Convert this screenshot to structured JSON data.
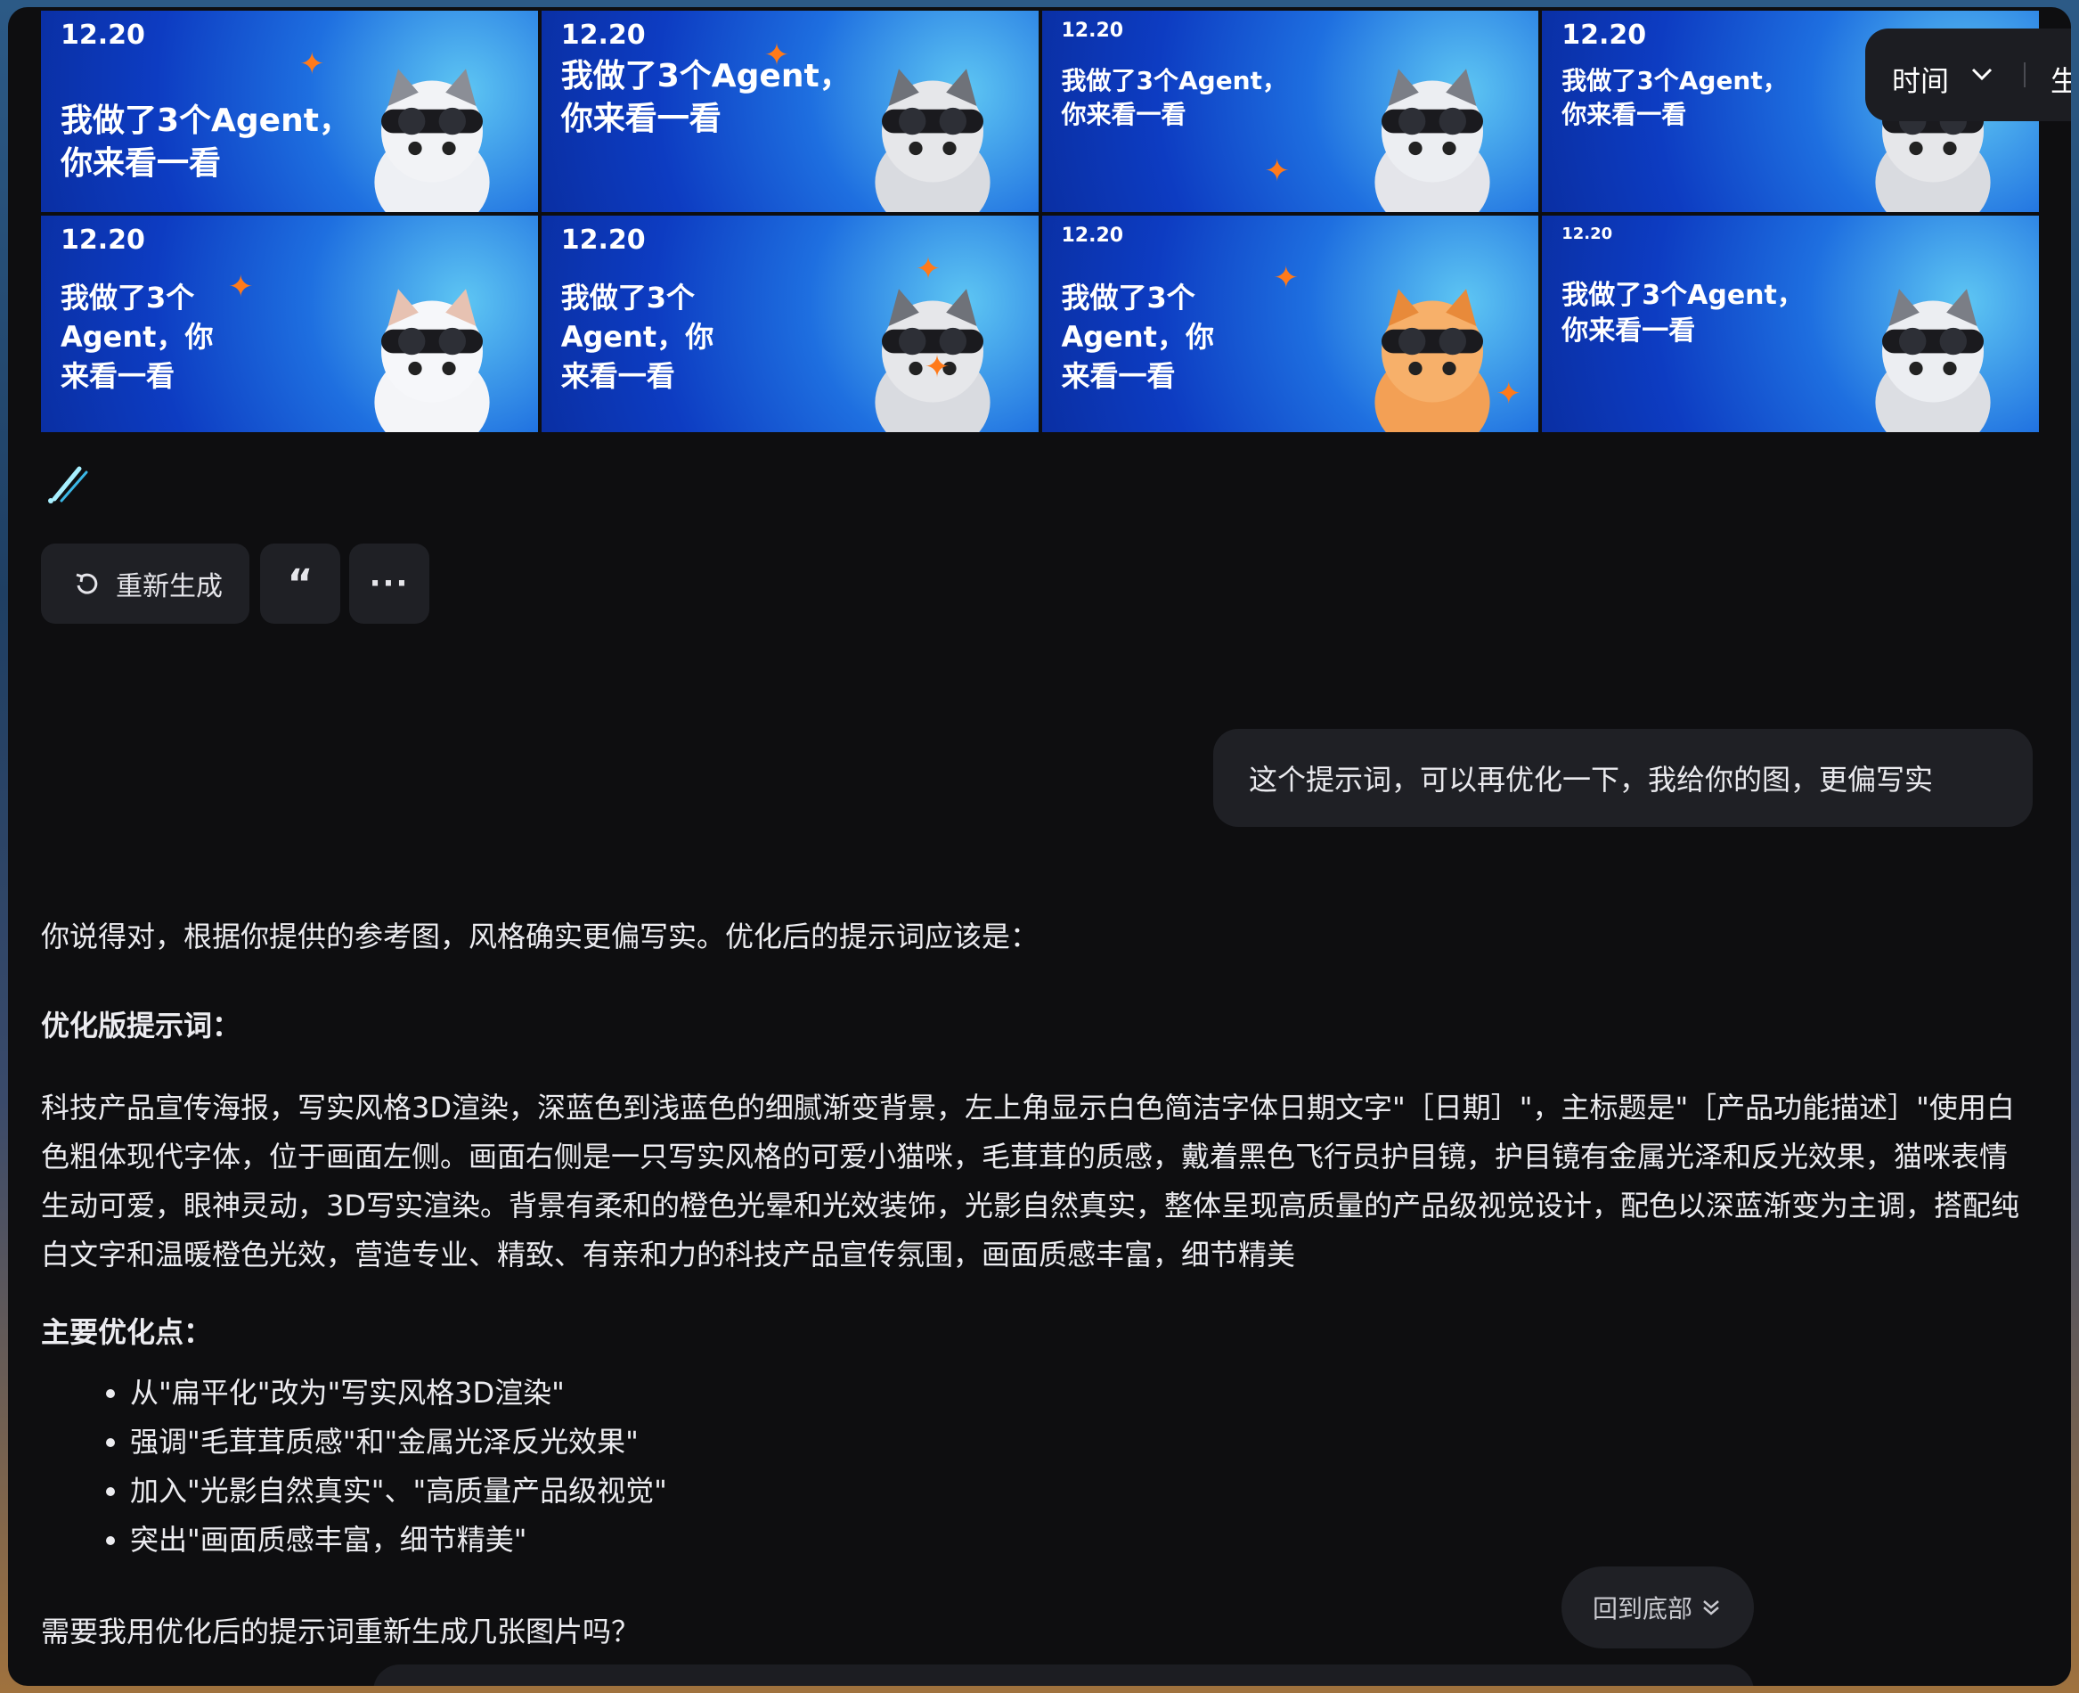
{
  "toolbar": {
    "time_label": "时间",
    "gen_label": "生"
  },
  "posters": [
    {
      "date": "12.20",
      "title": "我做了3个Agent，你来看一看"
    },
    {
      "date": "12.20",
      "title": "我做了3个Agent，你来看一看"
    },
    {
      "date": "12.20",
      "title": "我做了3个Agent，你来看一看"
    },
    {
      "date": "12.20",
      "title": "我做了3个Agent，你来看一看"
    },
    {
      "date": "12.20",
      "title": "我做了3个Agent，你来看一看"
    },
    {
      "date": "12.20",
      "title": "我做了3个Agent，你来看一看"
    },
    {
      "date": "12.20",
      "title": "我做了3个Agent，你来看一看"
    },
    {
      "date": "12.20",
      "title": "我做了3个Agent，你来看一看"
    }
  ],
  "actions": {
    "regenerate": "重新生成",
    "quote": "“",
    "more": "···"
  },
  "user_message": "这个提示词，可以再优化一下，我给你的图，更偏写实",
  "answer": {
    "intro": "你说得对，根据你提供的参考图，风格确实更偏写实。优化后的提示词应该是：",
    "heading1": "优化版提示词：",
    "prompt": "科技产品宣传海报，写实风格3D渲染，深蓝色到浅蓝色的细腻渐变背景，左上角显示白色简洁字体日期文字\"［日期］\"，主标题是\"［产品功能描述］\"使用白色粗体现代字体，位于画面左侧。画面右侧是一只写实风格的可爱小猫咪，毛茸茸的质感，戴着黑色飞行员护目镜，护目镜有金属光泽和反光效果，猫咪表情生动可爱，眼神灵动，3D写实渲染。背景有柔和的橙色光晕和光效装饰，光影自然真实，整体呈现高质量的产品级视觉设计，配色以深蓝渐变为主调，搭配纯白文字和温暖橙色光效，营造专业、精致、有亲和力的科技产品宣传氛围，画面质感丰富，细节精美",
    "heading2": "主要优化点：",
    "points": [
      "从\"扁平化\"改为\"写实风格3D渲染\"",
      "强调\"毛茸茸质感\"和\"金属光泽反光效果\"",
      "加入\"光影自然真实\"、\"高质量产品级视觉\"",
      "突出\"画面质感丰富，细节精美\""
    ],
    "closing": "需要我用优化后的提示词重新生成几张图片吗？"
  },
  "back_to_bottom": "回到底部"
}
